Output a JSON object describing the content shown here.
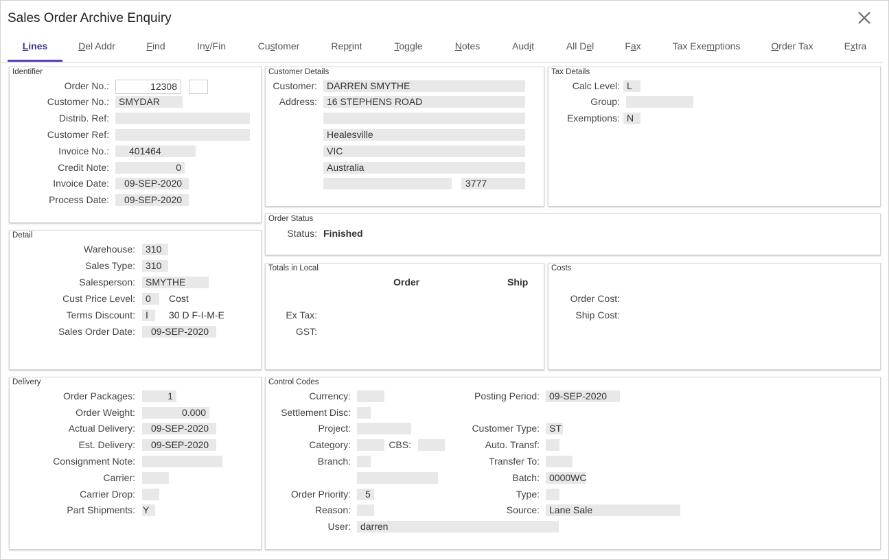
{
  "window": {
    "title": "Sales Order Archive Enquiry",
    "close_icon": "close-icon"
  },
  "tabs": [
    {
      "pre": "",
      "u": "L",
      "post": "ines"
    },
    {
      "pre": "",
      "u": "D",
      "post": "el Addr"
    },
    {
      "pre": "",
      "u": "F",
      "post": "ind"
    },
    {
      "pre": "In",
      "u": "v",
      "post": "/Fin"
    },
    {
      "pre": "Cu",
      "u": "s",
      "post": "tomer"
    },
    {
      "pre": "Rep",
      "u": "r",
      "post": "int"
    },
    {
      "pre": "",
      "u": "T",
      "post": "oggle"
    },
    {
      "pre": "",
      "u": "N",
      "post": "otes"
    },
    {
      "pre": "Aud",
      "u": "i",
      "post": "t"
    },
    {
      "pre": "All D",
      "u": "e",
      "post": "l"
    },
    {
      "pre": "F",
      "u": "a",
      "post": "x"
    },
    {
      "pre": "Tax Exe",
      "u": "m",
      "post": "ptions"
    },
    {
      "pre": "",
      "u": "O",
      "post": "rder Tax"
    },
    {
      "pre": "E",
      "u": "x",
      "post": "tra"
    }
  ],
  "identifier": {
    "title": "Identifier",
    "order_no_label": "Order No.:",
    "order_no": "12308",
    "order_suffix": "",
    "customer_no_label": "Customer No.:",
    "customer_no": "SMYDAR",
    "distrib_ref_label": "Distrib. Ref:",
    "distrib_ref": "",
    "customer_ref_label": "Customer Ref:",
    "customer_ref": "",
    "invoice_no_label": "Invoice No.:",
    "invoice_no": "401464",
    "credit_note_label": "Credit Note:",
    "credit_note": "0",
    "invoice_date_label": "Invoice Date:",
    "invoice_date": "09-SEP-2020",
    "process_date_label": "Process Date:",
    "process_date": "09-SEP-2020"
  },
  "customer_details": {
    "title": "Customer Details",
    "customer_label": "Customer:",
    "customer": "DARREN SMYTHE",
    "address_label": "Address:",
    "address1": "16 STEPHENS ROAD",
    "address2": "",
    "address3": "Healesville",
    "address4": "VIC",
    "address5": "Australia",
    "address6": "",
    "postcode": "3777"
  },
  "tax_details": {
    "title": "Tax Details",
    "calc_level_label": "Calc Level:",
    "calc_level": "L",
    "group_label": "Group:",
    "group": "",
    "exemptions_label": "Exemptions:",
    "exemptions": "N"
  },
  "order_status": {
    "title": "Order Status",
    "status_label": "Status:",
    "status": "Finished"
  },
  "detail": {
    "title": "Detail",
    "warehouse_label": "Warehouse:",
    "warehouse": "310",
    "sales_type_label": "Sales Type:",
    "sales_type": "310",
    "salesperson_label": "Salesperson:",
    "salesperson": "SMYTHE",
    "cust_price_level_label": "Cust Price Level:",
    "cust_price_level": "0",
    "cust_price_level_desc": "Cost",
    "terms_discount_label": "Terms Discount:",
    "terms_discount": "I",
    "terms_discount_desc": "30 D F-I-M-E",
    "sales_order_date_label": "Sales Order Date:",
    "sales_order_date": "09-SEP-2020"
  },
  "totals": {
    "title": "Totals in Local",
    "order_header": "Order",
    "ship_header": "Ship",
    "ex_tax_label": "Ex Tax:",
    "gst_label": "GST:"
  },
  "costs": {
    "title": "Costs",
    "order_cost_label": "Order Cost:",
    "ship_cost_label": "Ship Cost:"
  },
  "delivery": {
    "title": "Delivery",
    "order_packages_label": "Order Packages:",
    "order_packages": "1",
    "order_weight_label": "Order Weight:",
    "order_weight": "0.000",
    "actual_delivery_label": "Actual Delivery:",
    "actual_delivery": "09-SEP-2020",
    "est_delivery_label": "Est. Delivery:",
    "est_delivery": "09-SEP-2020",
    "consignment_note_label": "Consignment Note:",
    "consignment_note": "",
    "carrier_label": "Carrier:",
    "carrier": "",
    "carrier_drop_label": "Carrier Drop:",
    "carrier_drop": "",
    "part_shipments_label": "Part Shipments:",
    "part_shipments": "Y"
  },
  "control_codes": {
    "title": "Control Codes",
    "currency_label": "Currency:",
    "currency": "",
    "settlement_disc_label": "Settlement Disc:",
    "settlement_disc": "",
    "project_label": "Project:",
    "project": "",
    "category_label": "Category:",
    "category": "",
    "cbs_label": "CBS:",
    "cbs": "",
    "branch_label": "Branch:",
    "branch": "",
    "branch_desc": "",
    "order_priority_label": "Order Priority:",
    "order_priority": "5",
    "reason_label": "Reason:",
    "reason": "",
    "user_label": "User:",
    "user": "darren",
    "posting_period_label": "Posting Period:",
    "posting_period": "09-SEP-2020",
    "customer_type_label": "Customer Type:",
    "customer_type": "ST",
    "auto_transf_label": "Auto. Transf:",
    "auto_transf": "",
    "transfer_to_label": "Transfer To:",
    "transfer_to": "",
    "batch_label": "Batch:",
    "batch": "0000WC",
    "type_label": "Type:",
    "type": "",
    "source_label": "Source:",
    "source": "Lane Sale"
  }
}
